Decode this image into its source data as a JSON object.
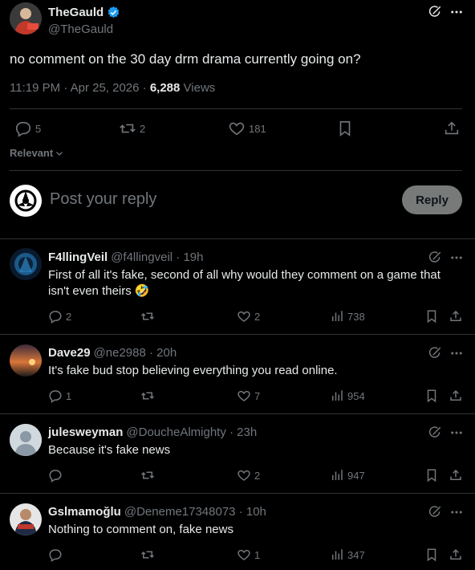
{
  "main": {
    "name": "TheGauld",
    "handle": "@TheGauld",
    "text": "no comment on the 30 day drm drama currently going on?",
    "time": "11:19 PM · Apr 25, 2026 · ",
    "views_count": "6,288",
    "views_label": " Views",
    "replies": "5",
    "reposts": "2",
    "likes": "181"
  },
  "sort_label": "Relevant",
  "composer": {
    "placeholder": "Post your reply",
    "reply_button": "Reply"
  },
  "replies": [
    {
      "name": "F4llingVeil",
      "handle": "@f4llingveil · 19h",
      "text": "First of all it's fake, second of all why would they comment on a game that isn't even theirs 🤣",
      "replies": "2",
      "reposts": "",
      "likes": "2",
      "views": "738",
      "avatar_color": "#0e2a44"
    },
    {
      "name": "Dave29",
      "handle": "@ne2988 · 20h",
      "text": "It's fake bud stop believing everything you read online.",
      "replies": "1",
      "reposts": "",
      "likes": "7",
      "views": "954",
      "avatar_color": "#a8552a"
    },
    {
      "name": "julesweyman",
      "handle": "@DoucheAlmighty · 23h",
      "text": "Because it's fake news",
      "replies": "",
      "reposts": "",
      "likes": "2",
      "views": "947",
      "avatar_color": "#b8c2cc"
    },
    {
      "name": "Gslmamoğlu",
      "handle": "@Deneme17348073 · 10h",
      "text": "Nothing to comment on, fake news",
      "replies": "",
      "reposts": "",
      "likes": "1",
      "views": "347",
      "avatar_color": "#7a2a2a"
    }
  ],
  "colors": {
    "background": "#000000",
    "text": "#e7e9ea",
    "muted": "#71767b",
    "divider": "#2f3336",
    "verified": "#1d9bf0",
    "reply_button_bg": "#787a7a"
  }
}
